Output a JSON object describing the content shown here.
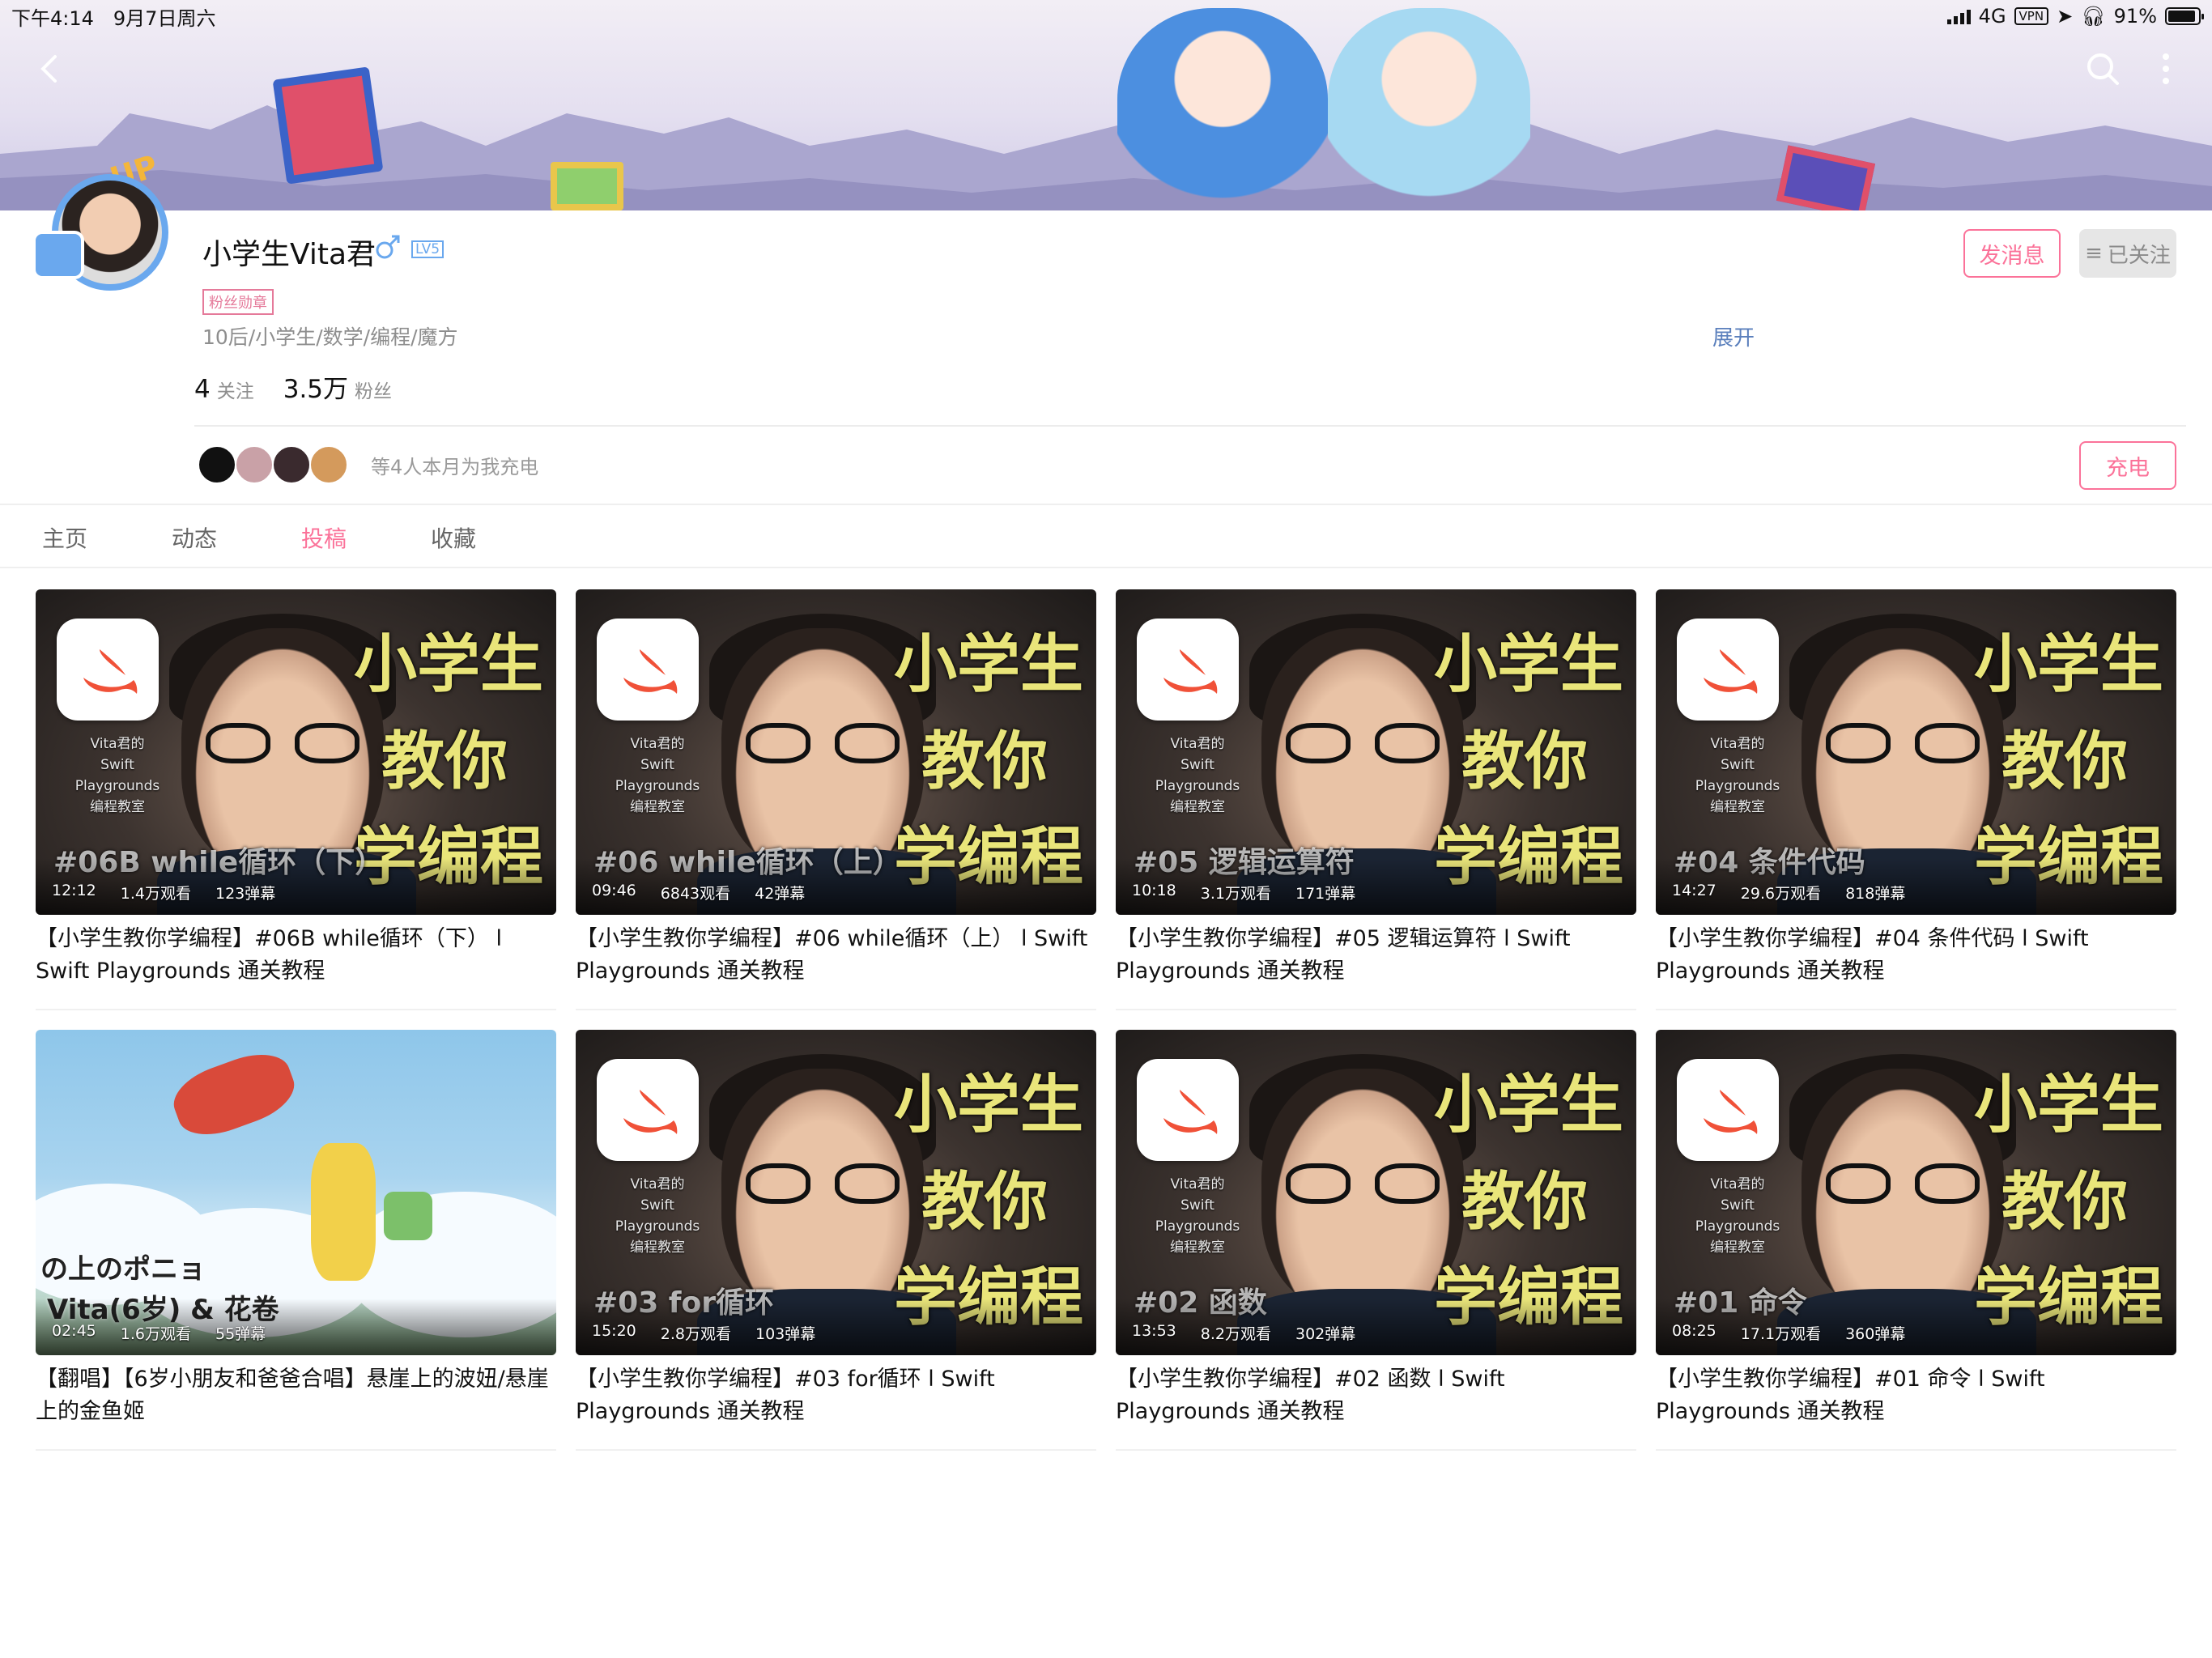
{
  "status_bar": {
    "time": "下午4:14",
    "date": "9月7日周六",
    "network": "4G",
    "vpn": "VPN",
    "battery": "91%",
    "battery_fraction": 0.91
  },
  "profile": {
    "username": "小学生Vita君",
    "fans_medal": "粉丝勋章",
    "bio": "10后/小学生/数学/编程/魔方",
    "expand": "展开",
    "following_count": "4",
    "following_label": "关注",
    "fans_count": "3.5万",
    "fans_label": "粉丝",
    "up_badge": "UP",
    "level_badge": "LV5"
  },
  "actions": {
    "message": "发消息",
    "followed": "已关注",
    "charge": "充电"
  },
  "charge_text": "等4人本月为我充电",
  "tabs": [
    "主页",
    "动态",
    "投稿",
    "收藏"
  ],
  "active_tab": "投稿",
  "videos": [
    {
      "title": "【小学生教你学编程】#06B while循环（下） l Swift Playgrounds 通关教程",
      "duration": "12:12",
      "views": "1.4万观看",
      "danmaku": "123弹幕",
      "ep": "#06B while循环（下）"
    },
    {
      "title": "【小学生教你学编程】#06 while循环（上） l Swift Playgrounds 通关教程",
      "duration": "09:46",
      "views": "6843观看",
      "danmaku": "42弹幕",
      "ep": "#06 while循环（上）"
    },
    {
      "title": "【小学生教你学编程】#05 逻辑运算符 l Swift Playgrounds 通关教程",
      "duration": "10:18",
      "views": "3.1万观看",
      "danmaku": "171弹幕",
      "ep": "#05 逻辑运算符"
    },
    {
      "title": "【小学生教你学编程】#04 条件代码 l Swift Playgrounds 通关教程",
      "duration": "14:27",
      "views": "29.6万观看",
      "danmaku": "818弹幕",
      "ep": "#04 条件代码"
    },
    {
      "title": "【翻唱】【6岁小朋友和爸爸合唱】悬崖上的波妞/悬崖上的金鱼姬",
      "duration": "02:45",
      "views": "1.6万观看",
      "danmaku": "55弹幕",
      "ep": "の上のポニョ",
      "ep2": "Vita(6岁) & 花卷"
    },
    {
      "title": "【小学生教你学编程】#03 for循环 l Swift Playgrounds 通关教程",
      "duration": "15:20",
      "views": "2.8万观看",
      "danmaku": "103弹幕",
      "ep": "#03 for循环"
    },
    {
      "title": "【小学生教你学编程】#02 函数 l Swift Playgrounds 通关教程",
      "duration": "13:53",
      "views": "8.2万观看",
      "danmaku": "302弹幕",
      "ep": "#02 函数"
    },
    {
      "title": "【小学生教你学编程】#01 命令 l Swift Playgrounds 通关教程",
      "duration": "08:25",
      "views": "17.1万观看",
      "danmaku": "360弹幕",
      "ep": "#01 命令"
    }
  ],
  "thumb_text": {
    "line1": "小学生",
    "line2": "教你",
    "line3": "学编程",
    "caption1": "Vita君的",
    "caption2": "Swift Playgrounds",
    "caption3": "编程教室"
  },
  "colors": {
    "accent": "#fb7299",
    "link": "#5a7fbc",
    "level": "#6aa8ee"
  }
}
